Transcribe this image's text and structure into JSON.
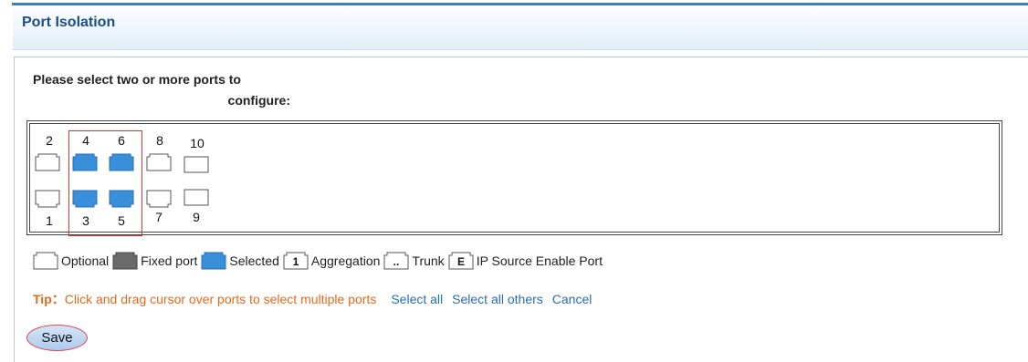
{
  "panel": {
    "title": "Port Isolation"
  },
  "instructions": {
    "line1": "Please select two or more ports to",
    "line2": "configure:"
  },
  "ports": {
    "top": [
      {
        "label": "2",
        "state": "optional"
      },
      {
        "label": "4",
        "state": "selected"
      },
      {
        "label": "6",
        "state": "selected"
      },
      {
        "label": "8",
        "state": "optional"
      },
      {
        "label": "10",
        "state": "sfp"
      }
    ],
    "bottom": [
      {
        "label": "1",
        "state": "optional"
      },
      {
        "label": "3",
        "state": "selected"
      },
      {
        "label": "5",
        "state": "selected"
      },
      {
        "label": "7",
        "state": "optional"
      },
      {
        "label": "9",
        "state": "sfp"
      }
    ]
  },
  "legend": {
    "optional": "Optional",
    "fixed": "Fixed port",
    "selected": "Selected",
    "aggregation": "Aggregation",
    "aggregation_glyph": "1",
    "trunk": "Trunk",
    "trunk_glyph": "..",
    "ipsource": "IP Source Enable Port",
    "ipsource_glyph": "E"
  },
  "tip": {
    "label": "Tip：",
    "text": "Click and drag cursor over ports to select multiple ports",
    "select_all": "Select all",
    "select_others": "Select all others",
    "cancel": "Cancel"
  },
  "save_label": "Save",
  "colors": {
    "selected": "#3a8fdb",
    "fixed": "#6b6b6b",
    "optional": "#ffffff",
    "tip": "#e66a1c",
    "link": "#2a6db5"
  }
}
